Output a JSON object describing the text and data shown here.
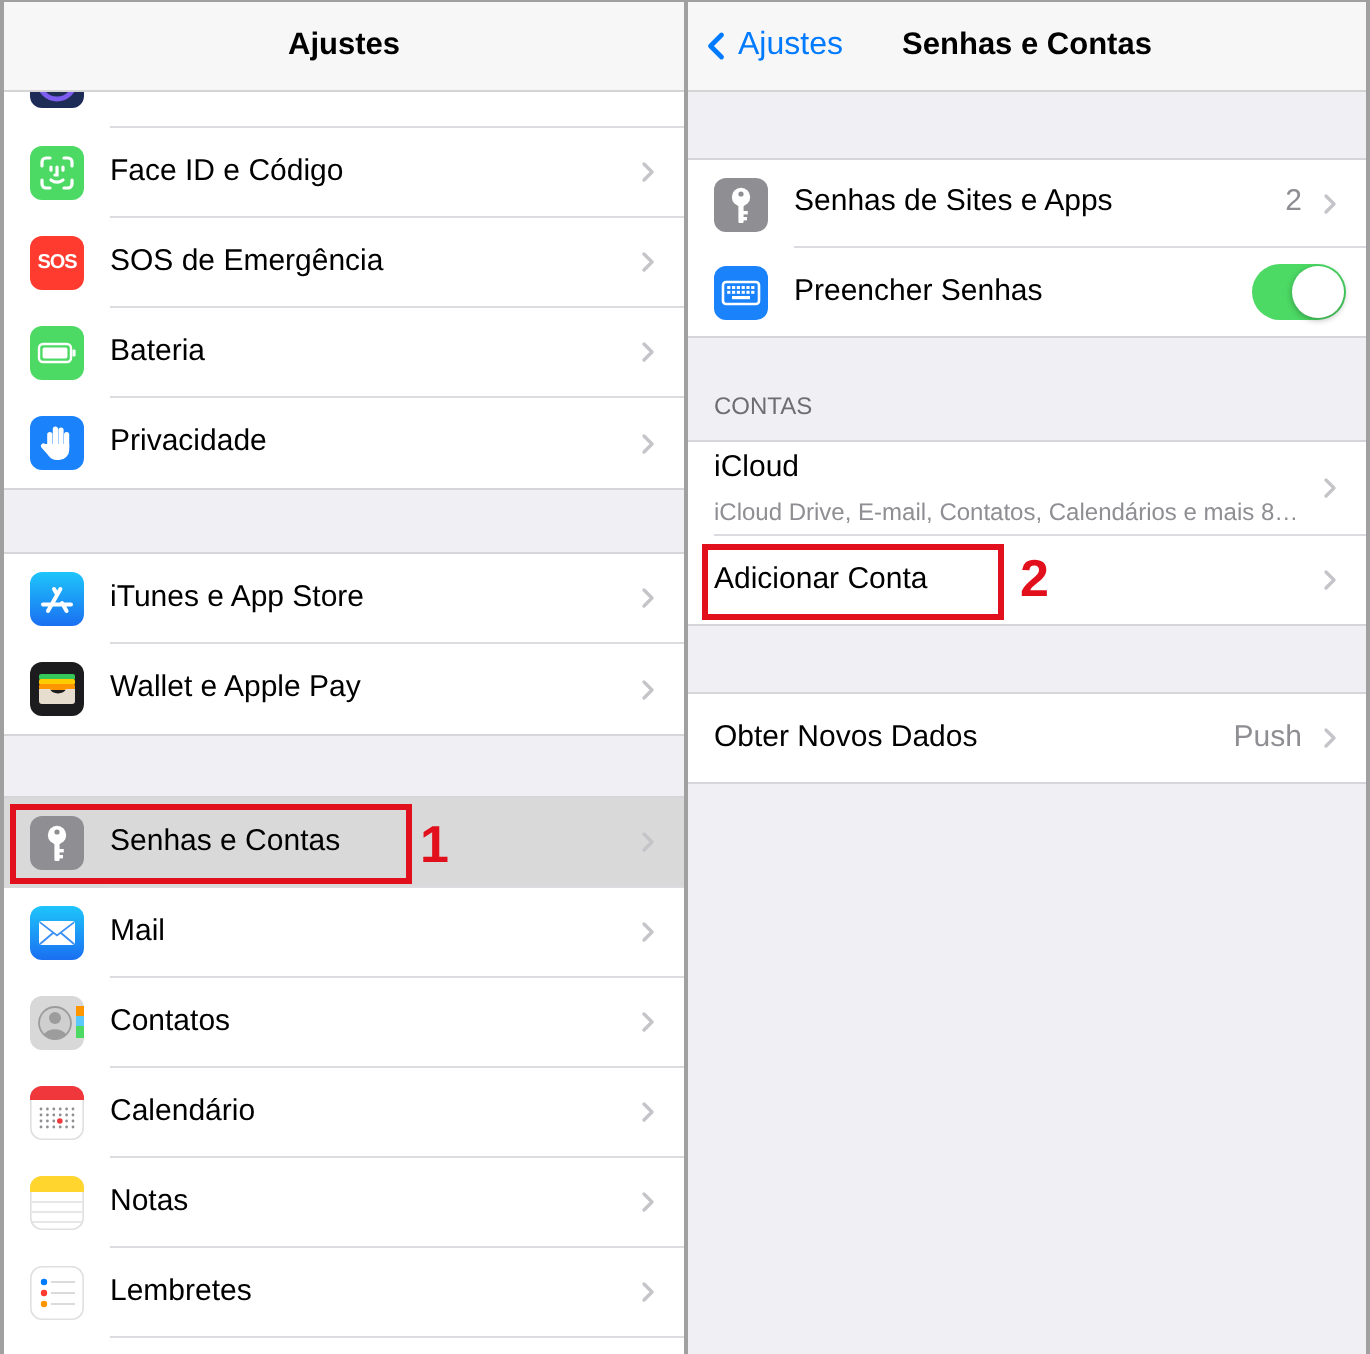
{
  "left_screen": {
    "nav_bar": {
      "title": "Ajustes"
    },
    "groups": [
      {
        "items": [
          {
            "label": "Face ID e Código",
            "selected": false
          },
          {
            "label": "SOS de Emergência",
            "icon_text": "SOS",
            "selected": false
          },
          {
            "label": "Bateria",
            "selected": false
          },
          {
            "label": "Privacidade",
            "selected": false
          }
        ]
      },
      {
        "items": [
          {
            "label": "iTunes e App Store",
            "selected": false
          },
          {
            "label": "Wallet e Apple Pay",
            "selected": false
          }
        ]
      },
      {
        "items": [
          {
            "label": "Senhas e Contas",
            "selected": true,
            "annotation": "1"
          },
          {
            "label": "Mail",
            "selected": false
          },
          {
            "label": "Contatos",
            "selected": false
          },
          {
            "label": "Calendário",
            "selected": false
          },
          {
            "label": "Notas",
            "selected": false
          },
          {
            "label": "Lembretes",
            "selected": false
          }
        ]
      }
    ]
  },
  "right_screen": {
    "nav_bar": {
      "back_label": "Ajustes",
      "title": "Senhas e Contas"
    },
    "groups": [
      {
        "items": [
          {
            "kind": "link",
            "label": "Senhas de Sites e Apps",
            "detail": "2"
          },
          {
            "kind": "toggle",
            "label": "Preencher Senhas",
            "on": true
          }
        ]
      },
      {
        "header": "CONTAS",
        "items": [
          {
            "kind": "link",
            "label": "iCloud",
            "subtitle": "iCloud Drive, E-mail, Contatos, Calendários e mais 8…"
          },
          {
            "kind": "link",
            "label": "Adicionar Conta",
            "annotation": "2"
          }
        ]
      },
      {
        "items": [
          {
            "kind": "link",
            "label": "Obter Novos Dados",
            "detail": "Push"
          }
        ]
      }
    ]
  }
}
